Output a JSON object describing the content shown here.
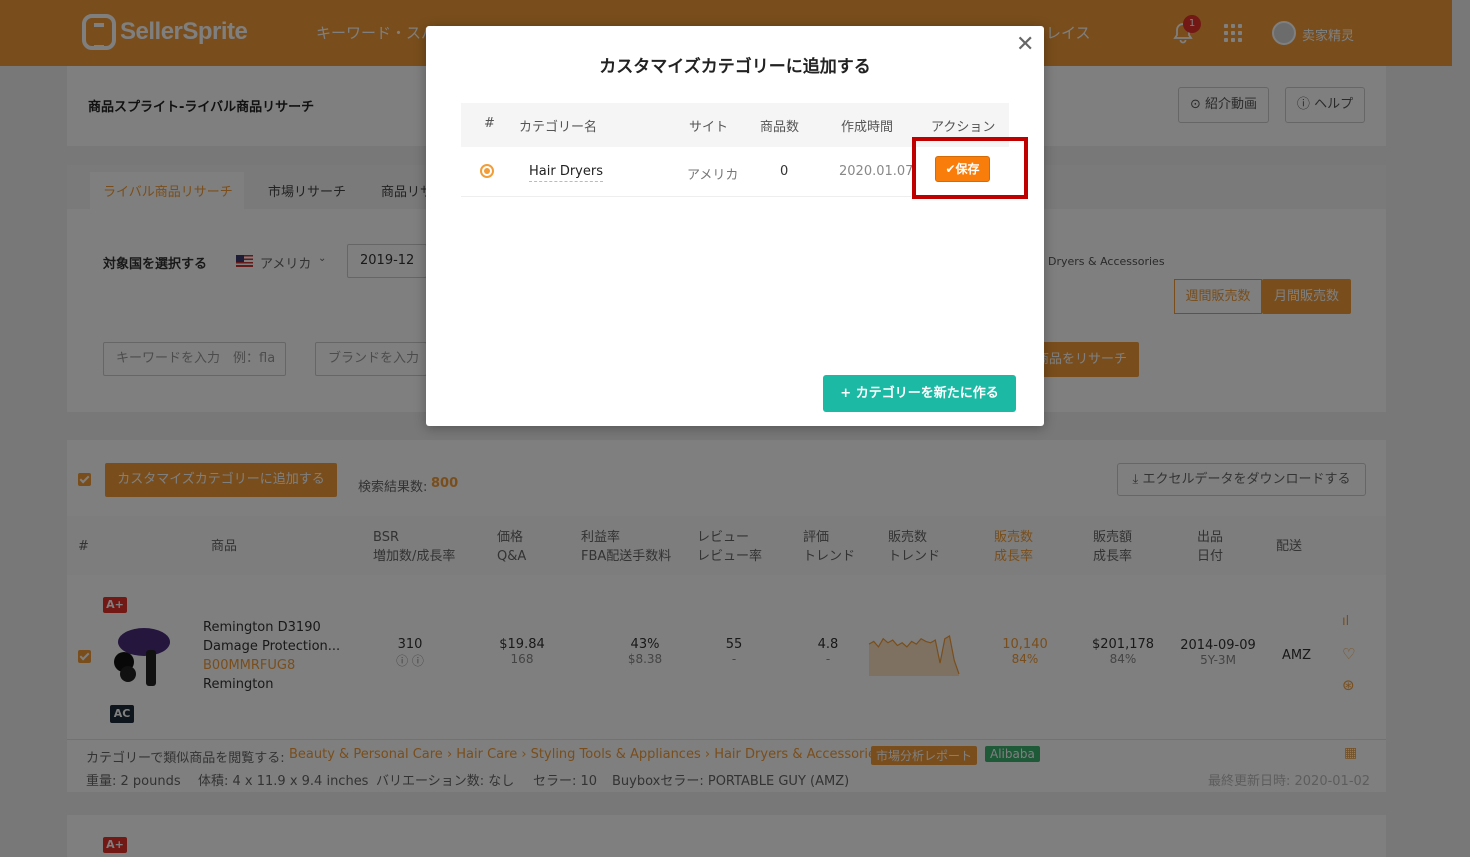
{
  "app": {
    "logo": "SellerSprite",
    "nav_text": "キーワード・スパ",
    "nav_text_right": "レイス",
    "notification_count": "1",
    "username": "卖家精灵"
  },
  "header": {
    "title": "商品スプライト-ライバル商品リサーチ",
    "intro_video": "紹介動画",
    "help": "ヘルプ"
  },
  "tabs": [
    {
      "label": "ライバル商品リサーチ"
    },
    {
      "label": "市場リサーチ"
    },
    {
      "label": "商品リサ"
    }
  ],
  "filters": {
    "country_label": "対象国を選択する",
    "country_value": "アメリカ",
    "month_value": "2019-12",
    "category_path_visible": "Dryers & Accessories",
    "weekly_sales": "週間販売数",
    "monthly_sales": "月間販売数",
    "keyword_placeholder": "キーワードを入力　例：fla",
    "brand_placeholder": "ブランドを入力",
    "search_button": "商品をリサーチ"
  },
  "results": {
    "add_to_category": "カスタマイズカテゴリーに追加する",
    "count_label": "検索結果数:",
    "count_value": "800",
    "download": "エクセルデータをダウンロードする"
  },
  "table_headers": {
    "index": "#",
    "product": "商品",
    "bsr": [
      "BSR",
      "増加数/成長率"
    ],
    "price": [
      "価格",
      "Q&A"
    ],
    "margin": [
      "利益率",
      "FBA配送手数料"
    ],
    "review": [
      "レビュー",
      "レビュー率"
    ],
    "rating": [
      "評価",
      "トレンド"
    ],
    "sales_trend": [
      "販売数",
      "トレンド"
    ],
    "sales_growth": [
      "販売数",
      "成長率"
    ],
    "revenue": [
      "販売額",
      "成長率"
    ],
    "listing": [
      "出品",
      "日付"
    ],
    "shipping": "配送"
  },
  "product": {
    "tag_top": "A+",
    "tag_bottom": "AC",
    "name_line1": "Remington D3190",
    "name_line2": "Damage Protection...",
    "asin": "B00MMRFUG8",
    "brand": "Remington",
    "bsr": "310",
    "price": "$19.84",
    "qa": "168",
    "margin": "43%",
    "fba": "$8.38",
    "reviews": "55",
    "review_rate": "-",
    "rating": "4.8",
    "rating_trend": "-",
    "sales": "10,140",
    "sales_growth": "84%",
    "revenue": "$201,178",
    "revenue_growth": "84%",
    "date": "2014-09-09",
    "age": "5Y-3M",
    "shipping": "AMZ",
    "sparkline": [
      32,
      34,
      30,
      36,
      33,
      35,
      31,
      33,
      30,
      34,
      32,
      36,
      34,
      33,
      35,
      18,
      36,
      38,
      20,
      10
    ]
  },
  "category_row": {
    "label": "カテゴリーで類似商品を閲覧する:",
    "path": "Beauty & Personal Care › Hair Care › Styling Tools & Appliances › Hair Dryers & Accessories",
    "market_report": "市場分析レポート",
    "alibaba": "Alibaba"
  },
  "details_row": {
    "weight": "重量: 2 pounds",
    "size": "体積: 4 x 11.9 x 9.4 inches",
    "variations": "バリエーション数: なし",
    "sellers": "セラー: 10",
    "buybox": "Buyboxセラー: PORTABLE GUY (AMZ)",
    "updated": "最終更新日時: 2020-01-02"
  },
  "next_row": {
    "tag_top": "A+"
  },
  "modal": {
    "title": "カスタマイズカテゴリーに追加する",
    "columns": [
      "#",
      "カテゴリー名",
      "サイト",
      "商品数",
      "作成時間",
      "アクション"
    ],
    "rows": [
      {
        "name": "Hair Dryers",
        "site": "アメリカ",
        "count": "0",
        "created": "2020.01.07",
        "action": "保存"
      }
    ],
    "new_category": "カテゴリーを新たに作る"
  },
  "colors": {
    "brand_orange": "#f29d38",
    "teal": "#1cbaa5",
    "highlight_red": "#c00000"
  }
}
